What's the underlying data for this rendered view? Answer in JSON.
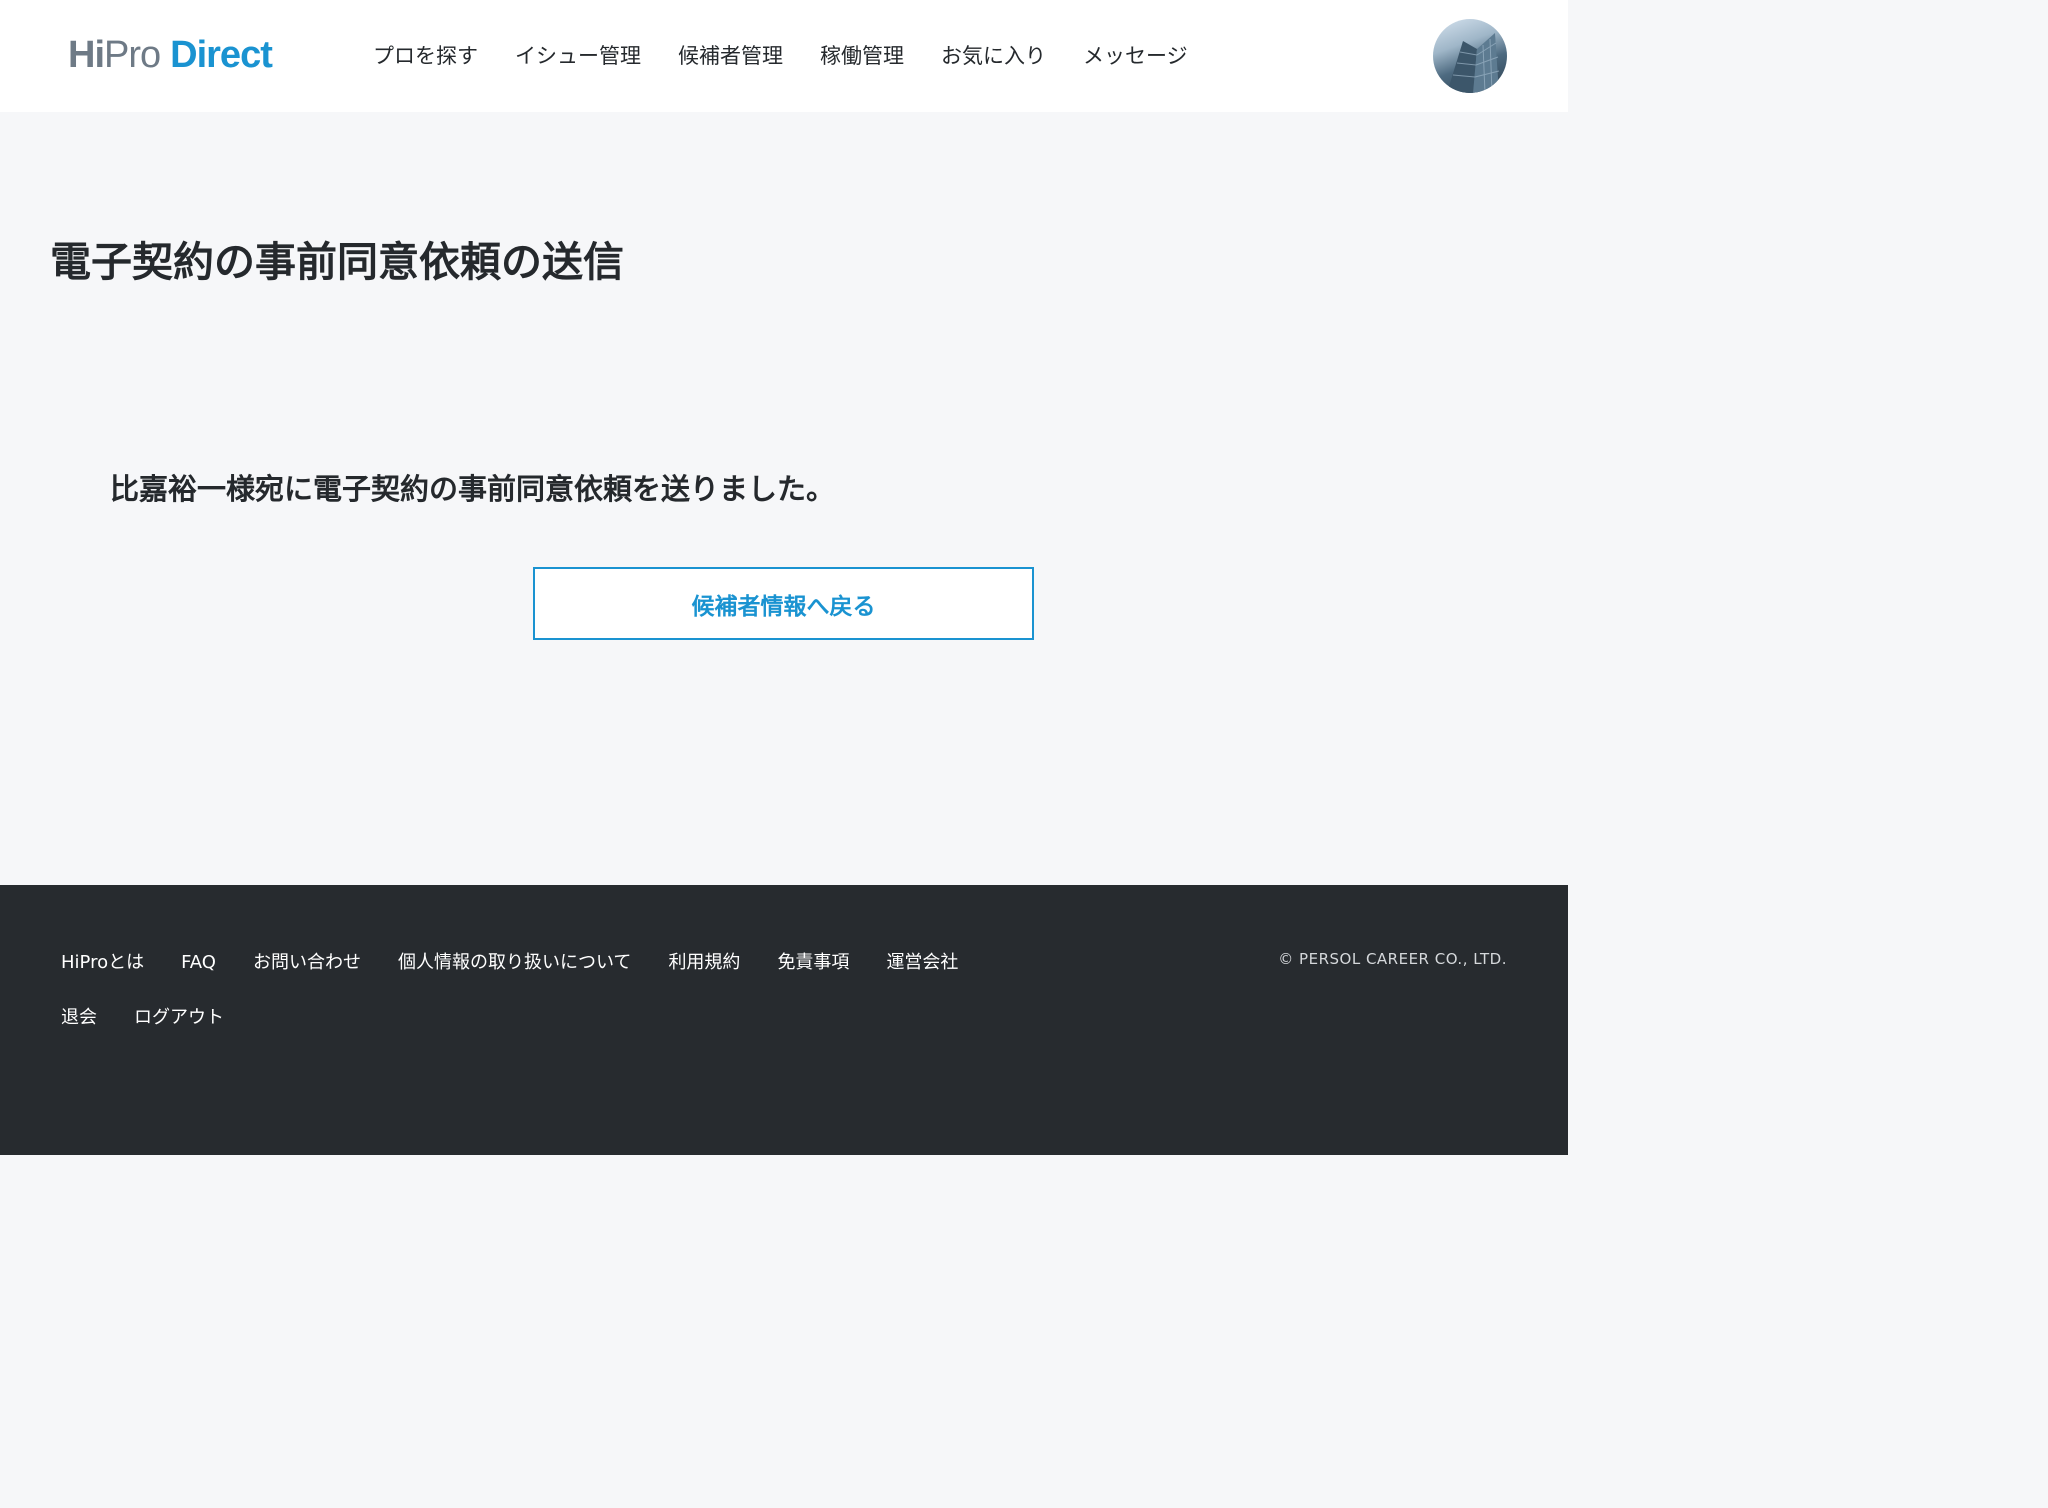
{
  "header": {
    "logo": {
      "part1": "Hi",
      "part2": "Pro",
      "part3": "Direct"
    },
    "nav": [
      {
        "label": "プロを探す"
      },
      {
        "label": "イシュー管理"
      },
      {
        "label": "候補者管理"
      },
      {
        "label": "稼働管理"
      },
      {
        "label": "お気に入り"
      },
      {
        "label": "メッセージ"
      }
    ]
  },
  "main": {
    "title": "電子契約の事前同意依頼の送信",
    "message": "比嘉裕一様宛に電子契約の事前同意依頼を送りました。",
    "back_button_label": "候補者情報へ戻る"
  },
  "footer": {
    "links_row1": [
      {
        "label": "HiProとは"
      },
      {
        "label": "FAQ"
      },
      {
        "label": "お問い合わせ"
      },
      {
        "label": "個人情報の取り扱いについて"
      },
      {
        "label": "利用規約"
      },
      {
        "label": "免責事項"
      },
      {
        "label": "運営会社"
      }
    ],
    "links_row2": [
      {
        "label": "退会"
      },
      {
        "label": "ログアウト"
      }
    ],
    "copyright": "© PERSOL CAREER CO., LTD."
  },
  "colors": {
    "accent": "#1a93d1",
    "footer_bg": "#272b2f",
    "page_bg": "#f6f7f9"
  }
}
